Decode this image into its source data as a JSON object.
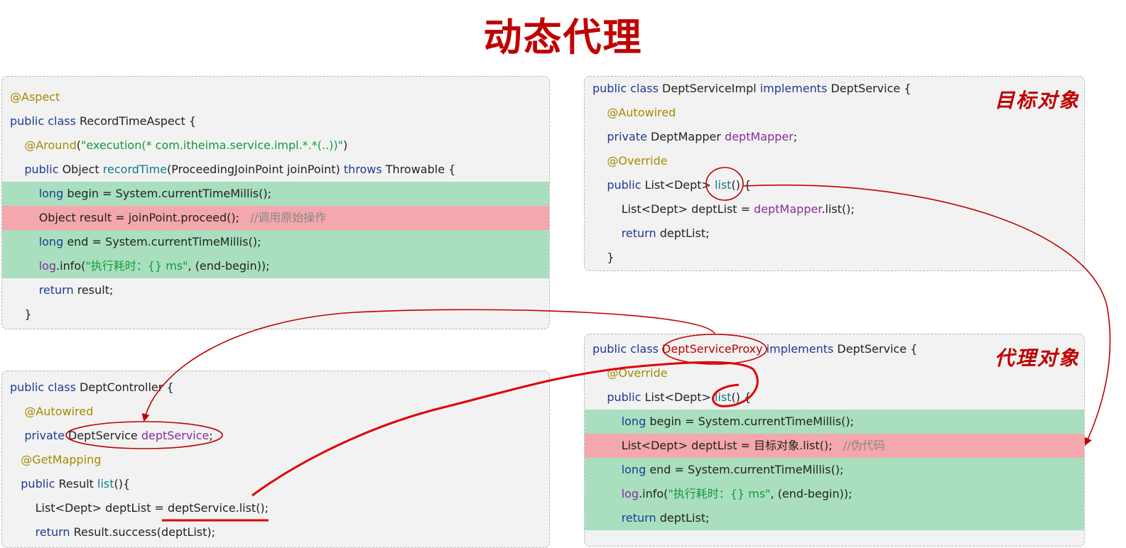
{
  "title": "动态代理",
  "aspect_box": {
    "lines": [
      {
        "parts": [
          {
            "t": "@Aspect",
            "c": "an"
          }
        ]
      },
      {
        "parts": [
          {
            "t": "public class ",
            "c": "kw"
          },
          {
            "t": "RecordTimeAspect {",
            "c": ""
          }
        ]
      },
      {
        "parts": [
          {
            "t": "    "
          },
          {
            "t": "@Around",
            "c": "an"
          },
          {
            "t": "("
          },
          {
            "t": "\"execution(* com.itheima.service.impl.*.*(..))\"",
            "c": "str"
          },
          {
            "t": ")"
          }
        ]
      },
      {
        "parts": [
          {
            "t": "    "
          },
          {
            "t": "public ",
            "c": "kw"
          },
          {
            "t": "Object "
          },
          {
            "t": "recordTime",
            "c": "mtd"
          },
          {
            "t": "(ProceedingJoinPoint joinPoint) "
          },
          {
            "t": "throws ",
            "c": "kw"
          },
          {
            "t": "Throwable {"
          }
        ]
      },
      {
        "hl": "green",
        "parts": [
          {
            "t": "        "
          },
          {
            "t": "long ",
            "c": "kw"
          },
          {
            "t": "begin = System.currentTimeMillis();"
          }
        ]
      },
      {
        "hl": "red",
        "parts": [
          {
            "t": "        Object result = joinPoint.proceed();   "
          },
          {
            "t": "//调用原始操作",
            "c": "cmt"
          }
        ]
      },
      {
        "hl": "green",
        "parts": [
          {
            "t": "        "
          },
          {
            "t": "long ",
            "c": "kw"
          },
          {
            "t": "end = System.currentTimeMillis();"
          }
        ]
      },
      {
        "hl": "green",
        "parts": [
          {
            "t": "        "
          },
          {
            "t": "log",
            "c": "fld"
          },
          {
            "t": ".info("
          },
          {
            "t": "\"执行耗时：{} ms\"",
            "c": "str"
          },
          {
            "t": ", (end-begin));"
          }
        ]
      },
      {
        "parts": [
          {
            "t": "        "
          },
          {
            "t": "return ",
            "c": "kw"
          },
          {
            "t": "result;"
          }
        ]
      },
      {
        "parts": [
          {
            "t": "    }"
          }
        ]
      }
    ]
  },
  "controller_box": {
    "lines": [
      {
        "parts": [
          {
            "t": "public class ",
            "c": "kw"
          },
          {
            "t": "DeptController {"
          }
        ]
      },
      {
        "parts": [
          {
            "t": "    "
          },
          {
            "t": "@Autowired",
            "c": "an"
          }
        ]
      },
      {
        "parts": [
          {
            "t": "    "
          },
          {
            "t": "private ",
            "c": "kw"
          },
          {
            "t": "DeptService "
          },
          {
            "t": "deptService",
            "c": "fld"
          },
          {
            "t": ";"
          }
        ]
      },
      {
        "parts": [
          {
            "t": "   "
          },
          {
            "t": "@GetMapping",
            "c": "an"
          }
        ]
      },
      {
        "parts": [
          {
            "t": "   "
          },
          {
            "t": "public ",
            "c": "kw"
          },
          {
            "t": "Result "
          },
          {
            "t": "list",
            "c": "mtd"
          },
          {
            "t": "(){"
          }
        ]
      },
      {
        "parts": [
          {
            "t": "       List<Dept> deptList = deptService.list();"
          }
        ]
      },
      {
        "parts": [
          {
            "t": "       "
          },
          {
            "t": "return ",
            "c": "kw"
          },
          {
            "t": "Result.success(deptList);"
          }
        ]
      }
    ]
  },
  "target_box": {
    "tag": "目标对象",
    "lines": [
      {
        "parts": [
          {
            "t": "public class ",
            "c": "kw"
          },
          {
            "t": "DeptServiceImpl "
          },
          {
            "t": "implements ",
            "c": "kw"
          },
          {
            "t": "DeptService {"
          }
        ]
      },
      {
        "parts": [
          {
            "t": "    "
          },
          {
            "t": "@Autowired",
            "c": "an"
          }
        ]
      },
      {
        "parts": [
          {
            "t": "    "
          },
          {
            "t": "private ",
            "c": "kw"
          },
          {
            "t": "DeptMapper "
          },
          {
            "t": "deptMapper",
            "c": "fld"
          },
          {
            "t": ";"
          }
        ]
      },
      {
        "parts": [
          {
            "t": "    "
          },
          {
            "t": "@Override",
            "c": "an"
          }
        ]
      },
      {
        "parts": [
          {
            "t": "    "
          },
          {
            "t": "public ",
            "c": "kw"
          },
          {
            "t": "List<Dept> "
          },
          {
            "t": "list",
            "c": "mtd"
          },
          {
            "t": "() {"
          }
        ]
      },
      {
        "parts": [
          {
            "t": "        List<Dept> deptList = "
          },
          {
            "t": "deptMapper",
            "c": "fld"
          },
          {
            "t": ".list();"
          }
        ]
      },
      {
        "parts": [
          {
            "t": "        "
          },
          {
            "t": "return ",
            "c": "kw"
          },
          {
            "t": "deptList;"
          }
        ]
      },
      {
        "parts": [
          {
            "t": "    }"
          }
        ]
      }
    ]
  },
  "proxy_box": {
    "tag": "代理对象",
    "lines": [
      {
        "parts": [
          {
            "t": "public class ",
            "c": "kw"
          },
          {
            "t": "DeptServiceProxy ",
            "c": "red"
          },
          {
            "t": "implements ",
            "c": "kw"
          },
          {
            "t": "DeptService {"
          }
        ]
      },
      {
        "parts": [
          {
            "t": "    "
          },
          {
            "t": "@Override",
            "c": "an"
          }
        ]
      },
      {
        "parts": [
          {
            "t": "    "
          },
          {
            "t": "public ",
            "c": "kw"
          },
          {
            "t": "List<Dept> "
          },
          {
            "t": "list",
            "c": "mtd"
          },
          {
            "t": "() {"
          }
        ]
      },
      {
        "hl": "green",
        "parts": [
          {
            "t": "        "
          },
          {
            "t": "long ",
            "c": "kw"
          },
          {
            "t": "begin = System.currentTimeMillis();"
          }
        ]
      },
      {
        "hl": "red",
        "parts": [
          {
            "t": "        List<Dept> deptList = 目标对象.list();   "
          },
          {
            "t": "//伪代码",
            "c": "cmt"
          }
        ]
      },
      {
        "hl": "green",
        "parts": [
          {
            "t": "        "
          },
          {
            "t": "long ",
            "c": "kw"
          },
          {
            "t": "end = System.currentTimeMillis();"
          }
        ]
      },
      {
        "hl": "green",
        "parts": [
          {
            "t": "        "
          },
          {
            "t": "log",
            "c": "fld"
          },
          {
            "t": ".info("
          },
          {
            "t": "\"执行耗时：{} ms\"",
            "c": "str"
          },
          {
            "t": ", (end-begin));"
          }
        ]
      },
      {
        "hl": "green",
        "parts": [
          {
            "t": "        "
          },
          {
            "t": "return ",
            "c": "kw"
          },
          {
            "t": "deptList;"
          }
        ]
      }
    ]
  },
  "colors": {
    "accent": "#c00000",
    "green_highlight": "#a9dfbf",
    "red_highlight": "#f4a7ad"
  }
}
